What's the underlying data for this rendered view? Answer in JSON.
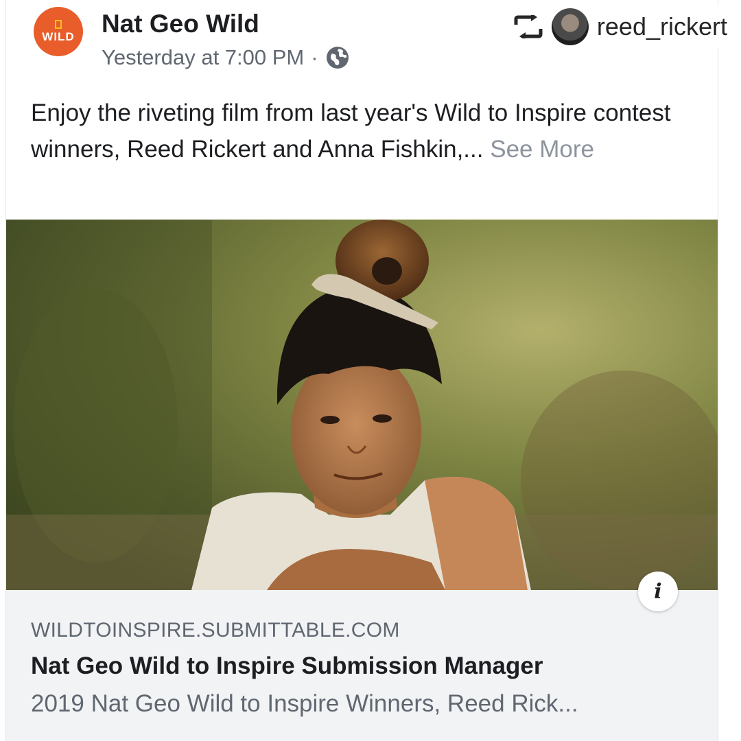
{
  "post": {
    "page_name": "Nat Geo Wild",
    "logo_text": "WILD",
    "timestamp": "Yesterday at 7:00 PM",
    "separator": "·",
    "privacy_icon": "globe-icon",
    "caption": "Enjoy the riveting film from last year's Wild to Inspire contest winners, Reed Rickert and Anna Fishkin,...",
    "see_more": "See More"
  },
  "repost": {
    "icon": "repost-icon",
    "username": "reed_rickert"
  },
  "link_preview": {
    "info_icon": "i",
    "domain": "WILDTOINSPIRE.SUBMITTABLE.COM",
    "title": "Nat Geo Wild to Inspire Submission Manager",
    "description": "2019 Nat Geo Wild to Inspire Winners, Reed Rick..."
  },
  "colors": {
    "logo_bg": "#e85d29",
    "text_primary": "#1c1e21",
    "text_secondary": "#606770",
    "link_bg": "#f2f3f5"
  }
}
